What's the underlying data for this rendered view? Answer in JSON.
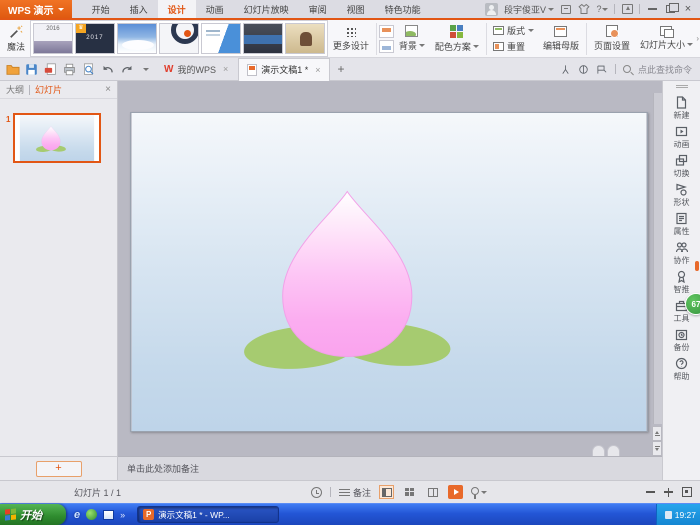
{
  "colors": {
    "brand_orange": "#e25614",
    "logo_orange": "#e8611d",
    "badge_green": "#3fae4e",
    "taskbar_blue": "#2356d6",
    "start_green": "#2e8b2e",
    "peach_pink": "#faa3ee",
    "leaf_green": "#a6cb70",
    "slide_bg_top": "#f5f8fb",
    "slide_bg_bottom": "#bed4e9"
  },
  "icons": {
    "caret": "▾",
    "close": "×",
    "plus": "+",
    "question": "?",
    "chevron_right": "›",
    "chevron_double": "»",
    "crown": "♛",
    "w_logo": "W",
    "p_logo": "P",
    "ie": "e"
  },
  "titlebar": {
    "logo": "WPS 演示",
    "tabs": [
      {
        "label": "开始"
      },
      {
        "label": "插入"
      },
      {
        "label": "设计"
      },
      {
        "label": "动画"
      },
      {
        "label": "幻灯片放映"
      },
      {
        "label": "审阅"
      },
      {
        "label": "视图"
      },
      {
        "label": "特色功能"
      }
    ],
    "username": "段宇俊亚V"
  },
  "ribbon": {
    "magic": "魔法",
    "templates": [
      {
        "text": "2016"
      },
      {
        "text": "2017"
      },
      {
        "text": ""
      },
      {
        "text": ""
      },
      {
        "text": ""
      },
      {
        "text": ""
      },
      {
        "text": ""
      }
    ],
    "more_designs": "更多设计",
    "background": "背景",
    "color_scheme": "配色方案",
    "layout": "版式",
    "reset": "重置",
    "edit_master": "编辑母版",
    "page_setup": "页面设置",
    "slide_size": "幻灯片大小"
  },
  "docbar": {
    "tab_my_wps": "我的WPS",
    "tab_document": "演示文稿1 *",
    "search_placeholder": "点此查找命令"
  },
  "left_panel": {
    "tab_outline": "大纲",
    "tab_slides": "幻灯片",
    "slide_number": "1"
  },
  "canvas": {
    "notes_placeholder": "单击此处添加备注"
  },
  "sidebar": {
    "items": [
      {
        "label": "新建"
      },
      {
        "label": "动画"
      },
      {
        "label": "切换"
      },
      {
        "label": "形状"
      },
      {
        "label": "属性"
      },
      {
        "label": "协作"
      },
      {
        "label": "智推"
      },
      {
        "label": "工具"
      },
      {
        "label": "备份"
      },
      {
        "label": "帮助"
      }
    ],
    "badge": "67"
  },
  "statusbar": {
    "slide_counter": "幻灯片 1 / 1",
    "notes": "备注"
  },
  "taskbar": {
    "start": "开始",
    "task": "演示文稿1 * - WP...",
    "time": "19:27"
  }
}
